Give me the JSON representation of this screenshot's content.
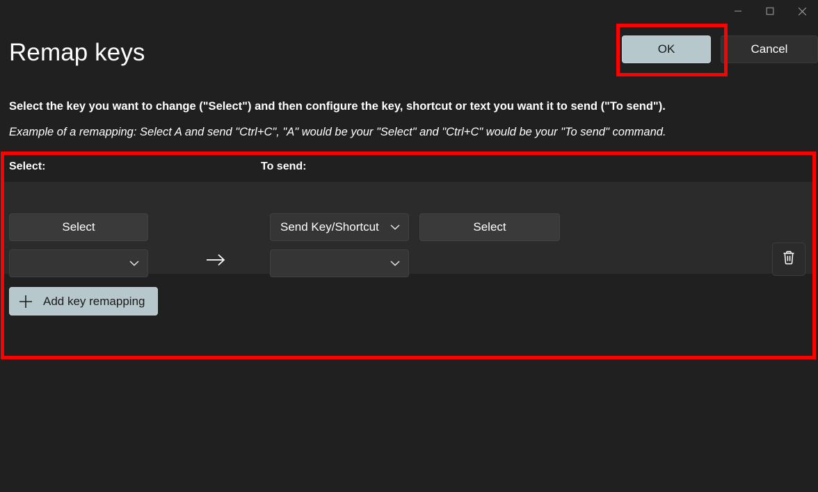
{
  "window": {
    "controls": [
      {
        "name": "minimize",
        "icon": "minimize-icon",
        "label": "Minimize"
      },
      {
        "name": "maximize",
        "icon": "maximize-icon",
        "label": "Maximize"
      },
      {
        "name": "close",
        "icon": "close-icon",
        "label": "Close"
      }
    ]
  },
  "header": {
    "title": "Remap keys",
    "ok_label": "OK",
    "cancel_label": "Cancel"
  },
  "description": {
    "line1": "Select the key you want to change (\"Select\") and then configure the key, shortcut or text you want it to send (\"To send\").",
    "line2": "Example of a remapping: Select A and send \"Ctrl+C\", \"A\" would be your \"Select\" and \"Ctrl+C\" would be your \"To send\" command."
  },
  "panel": {
    "col_select_header": "Select:",
    "col_tosend_header": "To send:",
    "rows": [
      {
        "select_button_label": "Select",
        "select_combo_value": "",
        "send_type_value": "Send Key/Shortcut",
        "send_combo_value": "",
        "send_button_label": "Select",
        "delete_icon": "trash-icon",
        "arrow_icon": "arrow-right-icon"
      }
    ],
    "add_button_label": "Add key remapping",
    "add_button_icon": "plus-icon"
  },
  "colors": {
    "page_background": "#202020",
    "row_background": "#2b2b2b",
    "control_background": "#353535",
    "accent_button": "#b7c8cc",
    "accent_button_text": "#1a1a1a",
    "highlight_outline": "#fe0000",
    "text_primary": "#ffffff"
  },
  "annotations": [
    {
      "name": "ok-button-highlight",
      "target": "OK"
    },
    {
      "name": "remap-panel-highlight",
      "target": "Remap rows panel"
    }
  ]
}
